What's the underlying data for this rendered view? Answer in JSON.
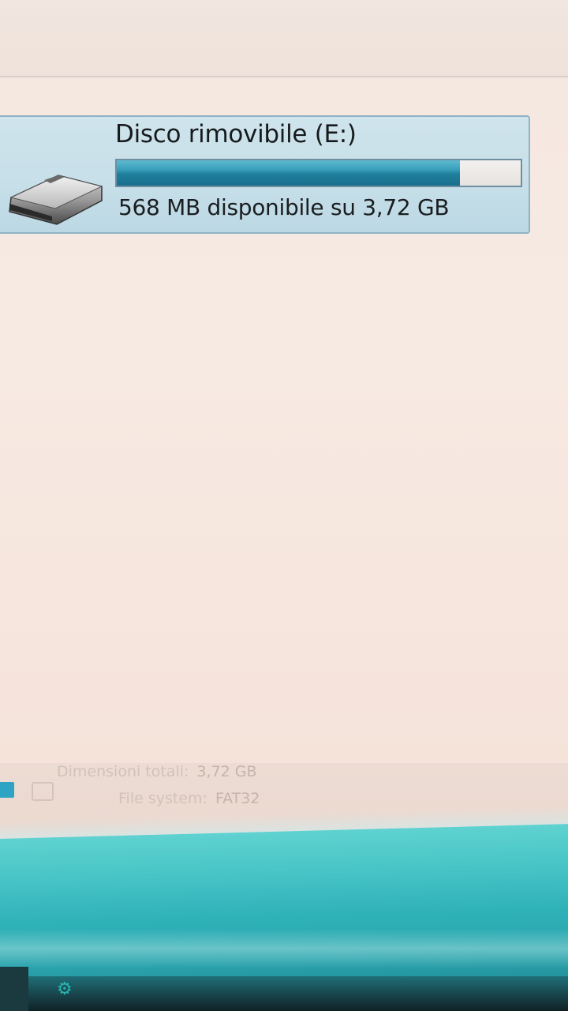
{
  "drive": {
    "title": "Disco rimovibile (E:)",
    "free_text": "568 MB disponibile su 3,72 GB",
    "used_fraction": 0.85,
    "icon": "usb-drive-icon"
  },
  "details": {
    "size_label": "Dimensioni totali:",
    "size_value": "3,72 GB",
    "fs_label": "File system:",
    "fs_value": "FAT32"
  },
  "colors": {
    "bar_fill": "#1e7f9c",
    "tile_bg": "#c6dfe9",
    "taskbar": "#2fb1b8"
  }
}
